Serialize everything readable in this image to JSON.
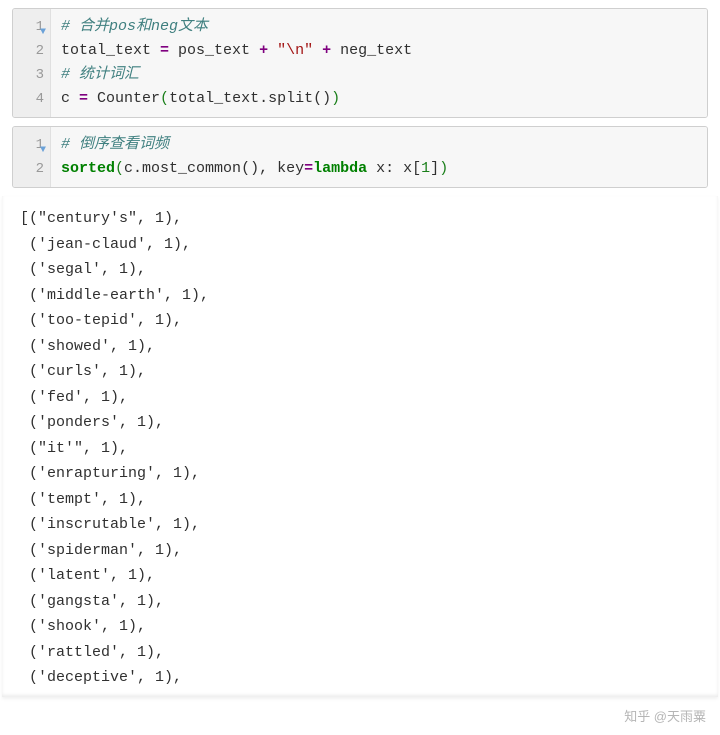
{
  "cell1": {
    "lines": [
      "1",
      "2",
      "3",
      "4"
    ],
    "comment1": "# 合并pos和neg文本",
    "l2_a": "total_text ",
    "l2_eq": "=",
    "l2_b": " pos_text ",
    "l2_plus1": "+",
    "l2_str": " \"\\n\" ",
    "l2_plus2": "+",
    "l2_c": " neg_text",
    "comment2": "# 统计词汇",
    "l4_a": "c ",
    "l4_eq": "=",
    "l4_b": " Counter",
    "l4_p1": "(",
    "l4_c": "total_text.split",
    "l4_p2": "()",
    "l4_p3": ")"
  },
  "cell2": {
    "lines": [
      "1",
      "2"
    ],
    "comment1": "# 倒序查看词频",
    "l2_sorted": "sorted",
    "l2_p1": "(",
    "l2_a": "c.most_common",
    "l2_p2": "()",
    "l2_b": ", key",
    "l2_eq": "=",
    "l2_lambda": "lambda",
    "l2_c": " x: x",
    "l2_br1": "[",
    "l2_num": "1",
    "l2_br2": "]",
    "l2_p3": ")"
  },
  "output": {
    "rows": [
      {
        "open": "[(",
        "word": "\"century's\"",
        "count": 1,
        "tail": "),"
      },
      {
        "open": " (",
        "word": "'jean-claud'",
        "count": 1,
        "tail": "),"
      },
      {
        "open": " (",
        "word": "'segal'",
        "count": 1,
        "tail": "),"
      },
      {
        "open": " (",
        "word": "'middle-earth'",
        "count": 1,
        "tail": "),"
      },
      {
        "open": " (",
        "word": "'too-tepid'",
        "count": 1,
        "tail": "),"
      },
      {
        "open": " (",
        "word": "'showed'",
        "count": 1,
        "tail": "),"
      },
      {
        "open": " (",
        "word": "'curls'",
        "count": 1,
        "tail": "),"
      },
      {
        "open": " (",
        "word": "'fed'",
        "count": 1,
        "tail": "),"
      },
      {
        "open": " (",
        "word": "'ponders'",
        "count": 1,
        "tail": "),"
      },
      {
        "open": " (",
        "word": "\"it'\"",
        "count": 1,
        "tail": "),"
      },
      {
        "open": " (",
        "word": "'enrapturing'",
        "count": 1,
        "tail": "),"
      },
      {
        "open": " (",
        "word": "'tempt'",
        "count": 1,
        "tail": "),"
      },
      {
        "open": " (",
        "word": "'inscrutable'",
        "count": 1,
        "tail": "),"
      },
      {
        "open": " (",
        "word": "'spiderman'",
        "count": 1,
        "tail": "),"
      },
      {
        "open": " (",
        "word": "'latent'",
        "count": 1,
        "tail": "),"
      },
      {
        "open": " (",
        "word": "'gangsta'",
        "count": 1,
        "tail": "),"
      },
      {
        "open": " (",
        "word": "'shook'",
        "count": 1,
        "tail": "),"
      },
      {
        "open": " (",
        "word": "'rattled'",
        "count": 1,
        "tail": "),"
      },
      {
        "open": " (",
        "word": "'deceptive'",
        "count": 1,
        "tail": "),"
      }
    ]
  },
  "watermark": "知乎 @天雨粟"
}
